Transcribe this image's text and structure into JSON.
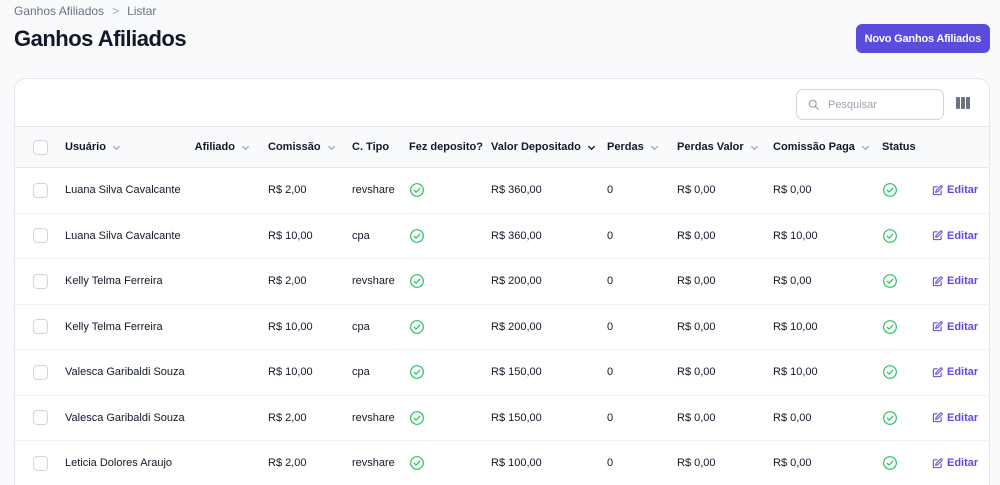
{
  "breadcrumb": {
    "parent": "Ganhos Afiliados",
    "separator": ">",
    "current": "Listar"
  },
  "page": {
    "title": "Ganhos Afiliados",
    "new_button": "Novo Ganhos Afiliados"
  },
  "toolbar": {
    "search_placeholder": "Pesquisar",
    "search_icon": "search-icon",
    "columns_icon": "columns-icon"
  },
  "colors": {
    "accent": "#5b4ce0",
    "success": "#22c55e",
    "border": "#e5e7eb"
  },
  "table": {
    "headers": {
      "usuario": "Usuário",
      "afiliado": "Afiliado",
      "comissao": "Comissão",
      "c_tipo": "C. Tipo",
      "fez_deposito": "Fez deposito?",
      "valor_depositado": "Valor Depositado",
      "perdas": "Perdas",
      "perdas_valor": "Perdas Valor",
      "comissao_paga": "Comissão Paga",
      "status": "Status"
    },
    "edit_label": "Editar",
    "rows": [
      {
        "usuario": "Luana Silva Cavalcante",
        "comissao": "R$ 2,00",
        "c_tipo": "revshare",
        "valor_depositado": "R$ 360,00",
        "perdas": "0",
        "perdas_valor": "R$ 0,00",
        "comissao_paga": "R$ 0,00"
      },
      {
        "usuario": "Luana Silva Cavalcante",
        "comissao": "R$ 10,00",
        "c_tipo": "cpa",
        "valor_depositado": "R$ 360,00",
        "perdas": "0",
        "perdas_valor": "R$ 0,00",
        "comissao_paga": "R$ 10,00"
      },
      {
        "usuario": "Kelly Telma Ferreira",
        "comissao": "R$ 2,00",
        "c_tipo": "revshare",
        "valor_depositado": "R$ 200,00",
        "perdas": "0",
        "perdas_valor": "R$ 0,00",
        "comissao_paga": "R$ 0,00"
      },
      {
        "usuario": "Kelly Telma Ferreira",
        "comissao": "R$ 10,00",
        "c_tipo": "cpa",
        "valor_depositado": "R$ 200,00",
        "perdas": "0",
        "perdas_valor": "R$ 0,00",
        "comissao_paga": "R$ 10,00"
      },
      {
        "usuario": "Valesca Garibaldi Souza",
        "comissao": "R$ 10,00",
        "c_tipo": "cpa",
        "valor_depositado": "R$ 150,00",
        "perdas": "0",
        "perdas_valor": "R$ 0,00",
        "comissao_paga": "R$ 10,00"
      },
      {
        "usuario": "Valesca Garibaldi Souza",
        "comissao": "R$ 2,00",
        "c_tipo": "revshare",
        "valor_depositado": "R$ 150,00",
        "perdas": "0",
        "perdas_valor": "R$ 0,00",
        "comissao_paga": "R$ 0,00"
      },
      {
        "usuario": "Leticia Dolores Araujo",
        "comissao": "R$ 2,00",
        "c_tipo": "revshare",
        "valor_depositado": "R$ 100,00",
        "perdas": "0",
        "perdas_valor": "R$ 0,00",
        "comissao_paga": "R$ 0,00"
      }
    ]
  }
}
